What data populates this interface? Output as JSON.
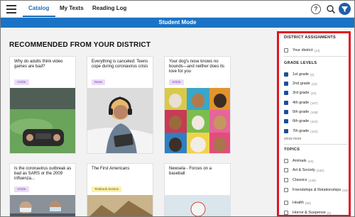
{
  "nav": {
    "tabs": [
      {
        "label": "Catalog",
        "active": true
      },
      {
        "label": "My Texts",
        "active": false
      },
      {
        "label": "Reading Log",
        "active": false
      }
    ],
    "help_label": "?",
    "icons": [
      "menu-icon",
      "help-icon",
      "search-icon",
      "filter-icon"
    ]
  },
  "banner": {
    "text": "Student Mode",
    "color": "#1a73c4"
  },
  "main": {
    "section_title": "RECOMMENDED FROM YOUR DISTRICT",
    "cards": [
      {
        "title": "Why do adults think video games are bad?",
        "tag": "Article"
      },
      {
        "title": "Everything is canceled: Teens cope during coronavirus crisis",
        "tag": "News"
      },
      {
        "title": "Your dog's nose knows no bounds—and neither does its love for you",
        "tag": "Article"
      },
      {
        "title": "Is the coronavirus outbreak as bad as SARS or the 2009 influenza...",
        "tag": "Article"
      },
      {
        "title": "The First Americans",
        "tag": "Textbook Section"
      },
      {
        "title": "Newsela - Forces on a baseball",
        "tag": ""
      }
    ]
  },
  "sidebar": {
    "district_heading": "DISTRICT ASSIGNMENTS",
    "district_items": [
      {
        "label": "Your district",
        "count": "(13)",
        "checked": false
      }
    ],
    "grade_heading": "GRADE LEVELS",
    "grade_items": [
      {
        "label": "1st grade",
        "count": "(0)",
        "checked": true
      },
      {
        "label": "2nd grade",
        "count": "(10)",
        "checked": true
      },
      {
        "label": "3rd grade",
        "count": "(24)",
        "checked": true
      },
      {
        "label": "4th grade",
        "count": "(187)",
        "checked": true
      },
      {
        "label": "5th grade",
        "count": "(108)",
        "checked": true
      },
      {
        "label": "6th grade",
        "count": "(422)",
        "checked": true
      },
      {
        "label": "7th grade",
        "count": "(423)",
        "checked": true
      }
    ],
    "show_more": "show more",
    "topics_heading": "TOPICS",
    "topic_items": [
      {
        "label": "Animals",
        "count": "(40)",
        "checked": false
      },
      {
        "label": "Art & Society",
        "count": "(150)",
        "checked": false
      },
      {
        "label": "Classics",
        "count": "(149)",
        "checked": false
      },
      {
        "label": "Friendships & Relationships",
        "count": "(19)",
        "checked": false
      },
      {
        "label": "Health",
        "count": "(80)",
        "checked": false
      },
      {
        "label": "Horror & Suspense",
        "count": "(0)",
        "checked": false
      }
    ],
    "highlight_color": "#e1141f"
  }
}
